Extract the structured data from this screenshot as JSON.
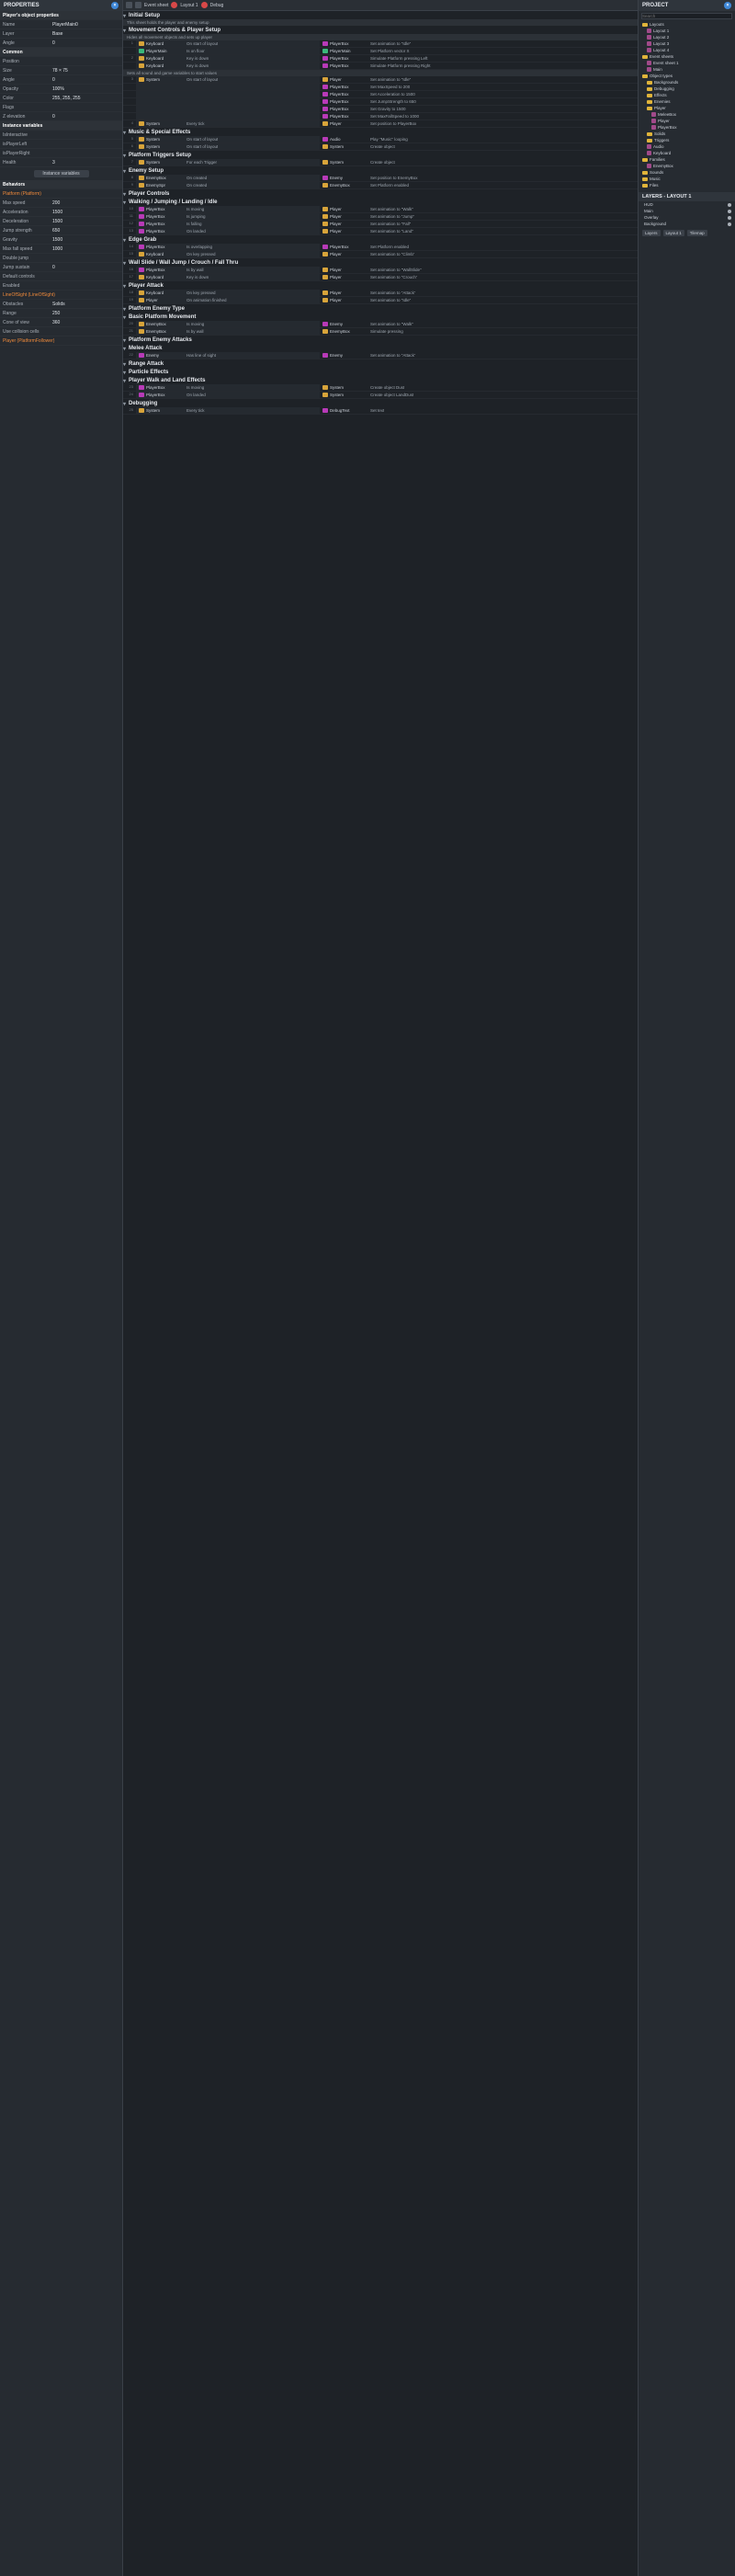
{
  "properties": {
    "title": "PROPERTIES",
    "object_header": "Player's object properties",
    "rows": [
      {
        "k": "Name",
        "v": "PlayerMain0"
      },
      {
        "k": "Layer",
        "v": "Base"
      },
      {
        "k": "Angle",
        "v": "0"
      }
    ],
    "common_section": "Common",
    "common_rows": [
      {
        "k": "Position",
        "v": ""
      },
      {
        "k": "Size",
        "v": "78 × 75"
      },
      {
        "k": "Angle",
        "v": "0"
      },
      {
        "k": "Opacity",
        "v": "100%"
      },
      {
        "k": "Color",
        "v": "255, 255, 255"
      },
      {
        "k": "Flags",
        "v": ""
      },
      {
        "k": "Z elevation",
        "v": "0"
      }
    ],
    "instance_vars_section": "Instance variables",
    "instance_vars": [
      {
        "name": "IsInteractive",
        "kind": "green",
        "v": ""
      },
      {
        "name": "isPlayerLeft",
        "kind": "green",
        "v": ""
      },
      {
        "name": "isPlayerRight",
        "kind": "green",
        "v": ""
      },
      {
        "name": "Health",
        "kind": "plain",
        "v": "3"
      }
    ],
    "add_var": "Instance variables",
    "behaviors_section": "Behaviors",
    "platform_label": "Platform (Platform)",
    "behaviors": [
      {
        "k": "Max speed",
        "v": "200"
      },
      {
        "k": "Acceleration",
        "v": "1500"
      },
      {
        "k": "Deceleration",
        "v": "1500"
      },
      {
        "k": "Jump strength",
        "v": "650"
      },
      {
        "k": "Gravity",
        "v": "1500"
      },
      {
        "k": "Max fall speed",
        "v": "1000"
      },
      {
        "k": "Double jump",
        "v": ""
      },
      {
        "k": "Jump sustain",
        "v": "0"
      },
      {
        "k": "Default controls",
        "v": ""
      },
      {
        "k": "Enabled",
        "v": ""
      }
    ],
    "lineofsight_label": "LineOfSight (LineOfSight)",
    "los_rows": [
      {
        "k": "Obstacles",
        "v": "Solids"
      },
      {
        "k": "Range",
        "v": "250"
      },
      {
        "k": "Cone of view",
        "v": "360"
      },
      {
        "k": "Use collision cells",
        "v": ""
      }
    ],
    "more_link": "Player (PlatformFollower)"
  },
  "toolbar": {
    "tab1": "Event sheet",
    "tab2": "Layout 1",
    "tab3": "Debug"
  },
  "events": [
    {
      "type": "header",
      "text": "Initial Setup",
      "comment": "This sheet holds the player and enemy setup"
    },
    {
      "type": "header",
      "text": "Movement Controls & Player Setup"
    },
    {
      "type": "comment",
      "text": "Hides all movement objects and sets up player"
    },
    {
      "type": "row",
      "ln": "1",
      "cond_obj": "Keyboard",
      "cond": "On start of layout",
      "act_obj": "PlayerBox",
      "act": "Set animation to \"Idle\""
    },
    {
      "type": "row",
      "ln": "",
      "cond_obj": "PlayerMain",
      "cond": "Is on floor",
      "act_obj": "PlayerMain",
      "act": "Set Platform vector X"
    },
    {
      "type": "row",
      "ln": "2",
      "cond_obj": "Keyboard",
      "cond": "Key is down",
      "act_obj": "PlayerBox",
      "act": "Simulate Platform pressing Left"
    },
    {
      "type": "row",
      "ln": "",
      "cond_obj": "Keyboard",
      "cond": "Key is down",
      "act_obj": "PlayerBox",
      "act": "Simulate Platform pressing Right"
    },
    {
      "type": "comment",
      "text": "Sets all sound and game variables to start values"
    },
    {
      "type": "row",
      "ln": "3",
      "cond_obj": "System",
      "cond": "On start of layout",
      "act_obj": "Player",
      "act": "Set animation to \"Idle\""
    },
    {
      "type": "row",
      "ln": "",
      "cond_obj": "",
      "cond": "",
      "act_obj": "PlayerBox",
      "act": "Set MaxSpeed to 200"
    },
    {
      "type": "row",
      "ln": "",
      "cond_obj": "",
      "cond": "",
      "act_obj": "PlayerBox",
      "act": "Set Acceleration to 1500"
    },
    {
      "type": "row",
      "ln": "",
      "cond_obj": "",
      "cond": "",
      "act_obj": "PlayerBox",
      "act": "Set JumpStrength to 650"
    },
    {
      "type": "row",
      "ln": "",
      "cond_obj": "",
      "cond": "",
      "act_obj": "PlayerBox",
      "act": "Set Gravity to 1500"
    },
    {
      "type": "row",
      "ln": "",
      "cond_obj": "",
      "cond": "",
      "act_obj": "PlayerBox",
      "act": "Set MaxFallSpeed to 1000"
    },
    {
      "type": "row",
      "ln": "4",
      "cond_obj": "System",
      "cond": "Every tick",
      "act_obj": "Player",
      "act": "Set position to PlayerBox"
    },
    {
      "type": "header",
      "text": "Music & Special Effects"
    },
    {
      "type": "row",
      "ln": "5",
      "cond_obj": "System",
      "cond": "On start of layout",
      "act_obj": "Audio",
      "act": "Play \"Music\" looping"
    },
    {
      "type": "row",
      "ln": "6",
      "cond_obj": "System",
      "cond": "On start of layout",
      "act_obj": "System",
      "act": "Create object"
    },
    {
      "type": "header",
      "text": "Platform Triggers Setup"
    },
    {
      "type": "row",
      "ln": "7",
      "cond_obj": "System",
      "cond": "For each Trigger",
      "act_obj": "System",
      "act": "Create object"
    },
    {
      "type": "header",
      "text": "Enemy Setup"
    },
    {
      "type": "row",
      "ln": "8",
      "cond_obj": "EnemyBox",
      "cond": "On created",
      "act_obj": "Enemy",
      "act": "Set position to EnemyBox"
    },
    {
      "type": "row",
      "ln": "9",
      "cond_obj": "EnemySpr",
      "cond": "On created",
      "act_obj": "EnemyBox",
      "act": "Set Platform enabled"
    },
    {
      "type": "header",
      "text": "Player Controls"
    },
    {
      "type": "header",
      "text": "Walking / Jumping / Landing / Idle"
    },
    {
      "type": "row",
      "ln": "10",
      "cond_obj": "PlayerBox",
      "cond": "Is moving",
      "act_obj": "Player",
      "act": "Set animation to \"Walk\""
    },
    {
      "type": "row",
      "ln": "11",
      "cond_obj": "PlayerBox",
      "cond": "Is jumping",
      "act_obj": "Player",
      "act": "Set animation to \"Jump\""
    },
    {
      "type": "row",
      "ln": "12",
      "cond_obj": "PlayerBox",
      "cond": "Is falling",
      "act_obj": "Player",
      "act": "Set animation to \"Fall\""
    },
    {
      "type": "row",
      "ln": "13",
      "cond_obj": "PlayerBox",
      "cond": "On landed",
      "act_obj": "Player",
      "act": "Set animation to \"Land\""
    },
    {
      "type": "header",
      "text": "Edge Grab"
    },
    {
      "type": "row",
      "ln": "14",
      "cond_obj": "PlayerBox",
      "cond": "Is overlapping",
      "act_obj": "PlayerBox",
      "act": "Set Platform enabled"
    },
    {
      "type": "row",
      "ln": "15",
      "cond_obj": "Keyboard",
      "cond": "On key pressed",
      "act_obj": "Player",
      "act": "Set animation to \"Climb\""
    },
    {
      "type": "header",
      "text": "Wall Slide / Wall Jump / Crouch / Fall Thru"
    },
    {
      "type": "row",
      "ln": "16",
      "cond_obj": "PlayerBox",
      "cond": "Is by wall",
      "act_obj": "Player",
      "act": "Set animation to \"WallSlide\""
    },
    {
      "type": "row",
      "ln": "17",
      "cond_obj": "Keyboard",
      "cond": "Key is down",
      "act_obj": "Player",
      "act": "Set animation to \"Crouch\""
    },
    {
      "type": "header",
      "text": "Player Attack"
    },
    {
      "type": "row",
      "ln": "18",
      "cond_obj": "Keyboard",
      "cond": "On key pressed",
      "act_obj": "Player",
      "act": "Set animation to \"Attack\""
    },
    {
      "type": "row",
      "ln": "19",
      "cond_obj": "Player",
      "cond": "On animation finished",
      "act_obj": "Player",
      "act": "Set animation to \"Idle\""
    },
    {
      "type": "header",
      "text": "Platform Enemy Type"
    },
    {
      "type": "header",
      "text": "Basic Platform Movement"
    },
    {
      "type": "row",
      "ln": "20",
      "cond_obj": "EnemyBox",
      "cond": "Is moving",
      "act_obj": "Enemy",
      "act": "Set animation to \"Walk\""
    },
    {
      "type": "row",
      "ln": "21",
      "cond_obj": "EnemyBox",
      "cond": "Is by wall",
      "act_obj": "EnemyBox",
      "act": "Simulate pressing"
    },
    {
      "type": "header",
      "text": "Platform Enemy Attacks"
    },
    {
      "type": "header",
      "text": "Melee Attack"
    },
    {
      "type": "row",
      "ln": "22",
      "cond_obj": "Enemy",
      "cond": "Has line of sight",
      "act_obj": "Enemy",
      "act": "Set animation to \"Attack\""
    },
    {
      "type": "header",
      "text": "Range Attack"
    },
    {
      "type": "header",
      "text": "Particle Effects"
    },
    {
      "type": "header",
      "text": "Player Walk and Land Effects"
    },
    {
      "type": "row",
      "ln": "23",
      "cond_obj": "PlayerBox",
      "cond": "Is moving",
      "act_obj": "System",
      "act": "Create object Dust"
    },
    {
      "type": "row",
      "ln": "24",
      "cond_obj": "PlayerBox",
      "cond": "On landed",
      "act_obj": "System",
      "act": "Create object LandDust"
    },
    {
      "type": "header",
      "text": "Debugging"
    },
    {
      "type": "row",
      "ln": "25",
      "cond_obj": "System",
      "cond": "Every tick",
      "act_obj": "DebugText",
      "act": "Set text"
    }
  ],
  "project": {
    "title": "PROJECT",
    "search_placeholder": "Search",
    "items": [
      {
        "indent": 0,
        "kind": "folder",
        "label": "Layouts"
      },
      {
        "indent": 1,
        "kind": "spr",
        "label": "Layout 1"
      },
      {
        "indent": 1,
        "kind": "spr",
        "label": "Layout 2"
      },
      {
        "indent": 1,
        "kind": "spr",
        "label": "Layout 3"
      },
      {
        "indent": 1,
        "kind": "spr",
        "label": "Layout 4"
      },
      {
        "indent": 0,
        "kind": "folder",
        "label": "Event sheets"
      },
      {
        "indent": 1,
        "kind": "spr",
        "label": "Event sheet 1"
      },
      {
        "indent": 1,
        "kind": "spr",
        "label": "Main"
      },
      {
        "indent": 0,
        "kind": "folder",
        "label": "Object types"
      },
      {
        "indent": 1,
        "kind": "folder",
        "label": "Backgrounds"
      },
      {
        "indent": 1,
        "kind": "folder",
        "label": "Debugging"
      },
      {
        "indent": 1,
        "kind": "folder",
        "label": "Effects"
      },
      {
        "indent": 1,
        "kind": "folder",
        "label": "Enemies"
      },
      {
        "indent": 1,
        "kind": "folder",
        "label": "Player"
      },
      {
        "indent": 2,
        "kind": "spr",
        "label": "MeleeBox"
      },
      {
        "indent": 2,
        "kind": "spr",
        "label": "Player"
      },
      {
        "indent": 2,
        "kind": "spr",
        "label": "PlayerBox"
      },
      {
        "indent": 1,
        "kind": "folder",
        "label": "Solids"
      },
      {
        "indent": 1,
        "kind": "folder",
        "label": "Triggers"
      },
      {
        "indent": 1,
        "kind": "spr",
        "label": "Audio"
      },
      {
        "indent": 1,
        "kind": "spr",
        "label": "Keyboard"
      },
      {
        "indent": 0,
        "kind": "folder",
        "label": "Families"
      },
      {
        "indent": 1,
        "kind": "spr",
        "label": "EnemyBox"
      },
      {
        "indent": 0,
        "kind": "folder",
        "label": "Sounds"
      },
      {
        "indent": 0,
        "kind": "folder",
        "label": "Music"
      },
      {
        "indent": 0,
        "kind": "folder",
        "label": "Files"
      }
    ]
  },
  "layers": {
    "title": "LAYERS - LAYOUT 1",
    "items": [
      "HUD",
      "Main",
      "Overlay",
      "Background"
    ],
    "tab1": "Layers",
    "tab2": "Layout 1",
    "tab3": "Tilemap"
  }
}
